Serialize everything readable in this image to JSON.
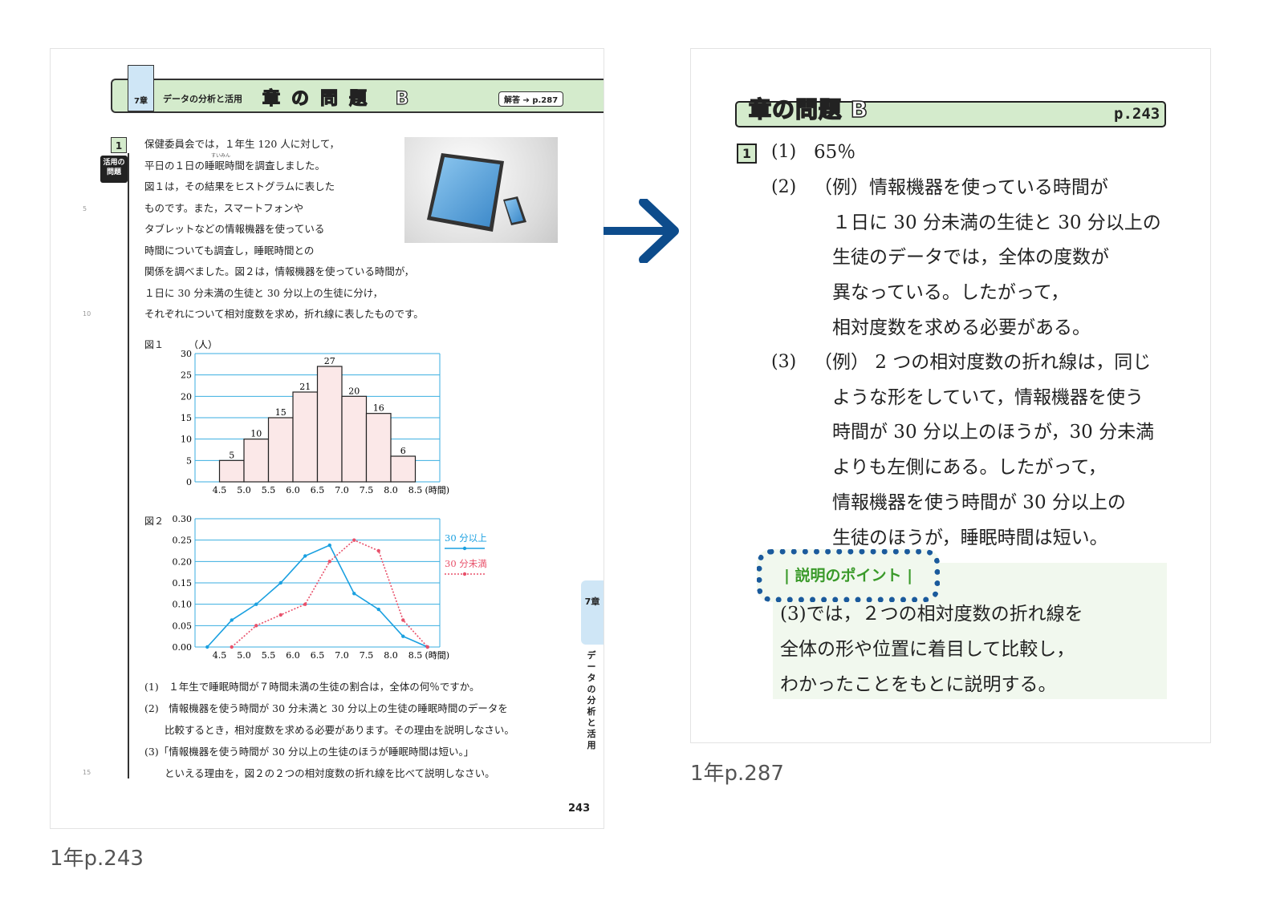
{
  "left": {
    "chapter_tab": "7章",
    "subject": "データの分析と活用",
    "title": "章の問題 B",
    "answer_ref": "解答 ➔ p.287",
    "problem_number": "1",
    "activity_badge": "活用の問題",
    "line_numbers": [
      "5",
      "10",
      "15"
    ],
    "ruby": "すいみん",
    "intro": "保健委員会では，１年生 120 人に対して，\n平日の１日の睡眠時間を調査しました。\n図１は，その結果をヒストグラムに表した\nものです。また，スマートフォンや\nタブレットなどの情報機器を使っている\n時間についても調査し，睡眠時間との\n関係を調べました。図２は，情報機器を使っている時間が，\n１日に 30 分未満の生徒と 30 分以上の生徒に分け，\nそれぞれについて相対度数を求め，折れ線に表したものです。",
    "fig1_label": "図１",
    "fig2_label": "図２",
    "questions": "(1)　１年生で睡眠時間が７時間未満の生徒の割合は，全体の何％ですか。\n(2)　情報機器を使う時間が 30 分未満と 30 分以上の生徒の睡眠時間のデータを\n　　比較するとき，相対度数を求める必要があります。その理由を説明しなさい。\n(3)「情報機器を使う時間が 30 分以上の生徒のほうが睡眠時間は短い。」\n　　といえる理由を，図２の２つの相対度数の折れ線を比べて説明しなさい。",
    "page_number": "243",
    "side_tab": "7章",
    "side_subject": "データの分析と活用",
    "caption": "1年p.243"
  },
  "chart_data": [
    {
      "type": "bar",
      "ylabel": "（人）",
      "xlabel": "(時間)",
      "x_ticks": [
        "4.5",
        "5.0",
        "5.5",
        "6.0",
        "6.5",
        "7.0",
        "7.5",
        "8.0",
        "8.5"
      ],
      "values": [
        5,
        10,
        15,
        21,
        27,
        20,
        16,
        6
      ],
      "data_labels": [
        "5",
        "10",
        "15",
        "21",
        "27",
        "20",
        "16",
        "6"
      ],
      "y_ticks": [
        "0",
        "5",
        "10",
        "15",
        "20",
        "25",
        "30"
      ],
      "ylim": [
        0,
        30
      ],
      "bar_color": "#fbe8e8",
      "grid_color": "#39aee0"
    },
    {
      "type": "line",
      "xlabel": "(時間)",
      "x_ticks": [
        "4.5",
        "5.0",
        "5.5",
        "6.0",
        "6.5",
        "7.0",
        "7.5",
        "8.0",
        "8.5"
      ],
      "y_ticks": [
        "0.00",
        "0.05",
        "0.10",
        "0.15",
        "0.20",
        "0.25",
        "0.30"
      ],
      "ylim": [
        0,
        0.3
      ],
      "x": [
        4.25,
        4.75,
        5.25,
        5.75,
        6.25,
        6.75,
        7.25,
        7.75,
        8.25,
        8.75
      ],
      "series": [
        {
          "name": "30 分以上",
          "values": [
            0,
            0.063,
            0.1,
            0.15,
            0.213,
            0.238,
            0.125,
            0.088,
            0.025,
            0
          ],
          "color": "#1aa0e0",
          "style": "solid"
        },
        {
          "name": "30 分未満",
          "values": [
            null,
            0,
            0.05,
            0.075,
            0.1,
            0.2,
            0.25,
            0.225,
            0.063,
            0
          ],
          "color": "#e8506a",
          "style": "dotted"
        }
      ]
    }
  ],
  "right": {
    "title": "章の問題 B",
    "page_ref": "p.243",
    "problem_number": "1",
    "labels": [
      "(1)",
      "(2)",
      "(3)"
    ],
    "ans1": "65％",
    "ans2": "（例）情報機器を使っている時間が\n　１日に 30 分未満の生徒と 30 分以上の\n　生徒のデータでは，全体の度数が\n　異なっている。したがって，\n　相対度数を求める必要がある。",
    "ans3": "（例） 2 つの相対度数の折れ線は，同じ\n　ような形をしていて，情報機器を使う\n　時間が 30 分以上のほうが，30 分未満\n　よりも左側にある。したがって，\n　情報機器を使う時間が 30 分以上の\n　生徒のほうが，睡眠時間は短い。",
    "point_tag": "| 説明のポイント |",
    "point_text": "(3)では，２つの相対度数の折れ線を\n全体の形や位置に着目して比較し，\nわかったことをもとに説明する。",
    "caption": "1年p.287"
  },
  "colors": {
    "green": "#d4ebcc",
    "blue_arrow": "#0d4c8c",
    "tab_blue": "#cfe6f6"
  }
}
